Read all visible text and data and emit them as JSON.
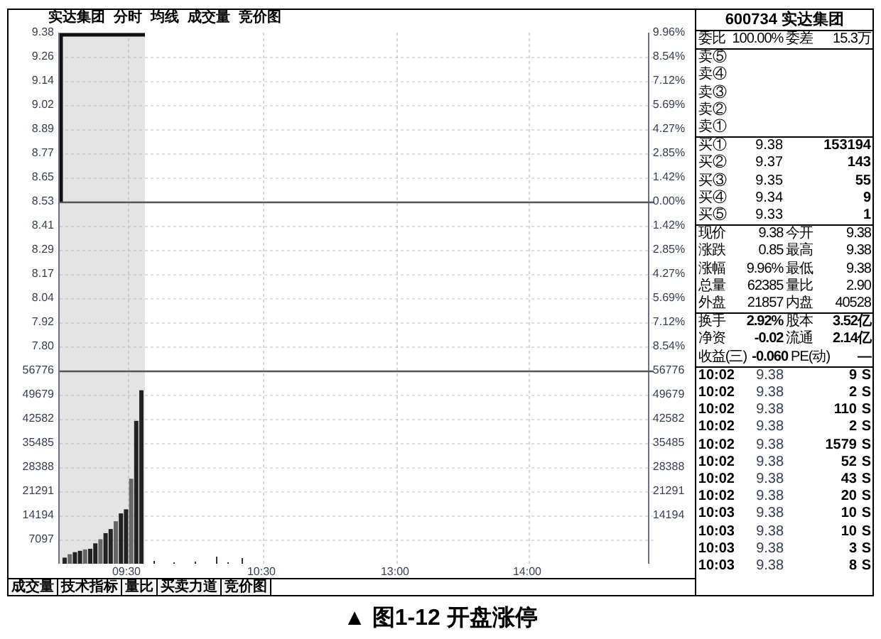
{
  "chart_header": [
    "实达集团",
    "分时",
    "均线",
    "成交量",
    "竞价图"
  ],
  "price_ticks": [
    "9.38",
    "9.26",
    "9.14",
    "9.02",
    "8.89",
    "8.77",
    "8.65",
    "8.53",
    "8.41",
    "8.29",
    "8.17",
    "8.04",
    "7.92",
    "7.80"
  ],
  "volume_ticks": [
    "56776",
    "49679",
    "42582",
    "35485",
    "28388",
    "21291",
    "14194",
    "7097"
  ],
  "percent_ticks": [
    "9.96%",
    "8.54%",
    "7.12%",
    "5.69%",
    "4.27%",
    "2.85%",
    "1.42%",
    "0.00%",
    "1.42%",
    "2.85%",
    "4.27%",
    "5.69%",
    "7.12%",
    "8.54%"
  ],
  "right_volume_ticks": [
    "56776",
    "49679",
    "42582",
    "35485",
    "28388",
    "21291",
    "14194"
  ],
  "time_ticks": [
    "09:30",
    "10:30",
    "13:00",
    "14:00"
  ],
  "bottom_tabs": [
    "成交量",
    "技术指标",
    "量比",
    "买卖力道",
    "竞价图"
  ],
  "quote": {
    "title": "600734 实达集团",
    "order_ratio": [
      "委比",
      "100.00%",
      "委差",
      "15.3万"
    ],
    "sell": [
      "卖⑤",
      "卖④",
      "卖③",
      "卖②",
      "卖①"
    ],
    "buy": [
      {
        "label": "买①",
        "price": "9.38",
        "volume": "153194"
      },
      {
        "label": "买②",
        "price": "9.37",
        "volume": "143"
      },
      {
        "label": "买③",
        "price": "9.35",
        "volume": "55"
      },
      {
        "label": "买④",
        "price": "9.34",
        "volume": "9"
      },
      {
        "label": "买⑤",
        "price": "9.33",
        "volume": "1"
      }
    ],
    "stats": [
      [
        "现价",
        "9.38",
        "今开",
        "9.38"
      ],
      [
        "涨跌",
        "0.85",
        "最高",
        "9.38"
      ],
      [
        "涨幅",
        "9.96%",
        "最低",
        "9.38"
      ],
      [
        "总量",
        "62385",
        "量比",
        "2.90"
      ],
      [
        "外盘",
        "21857",
        "内盘",
        "40528"
      ]
    ],
    "stats2": [
      [
        "换手",
        "2.92%",
        "股本",
        "3.52亿"
      ],
      [
        "净资",
        "-0.02",
        "流通",
        "2.14亿"
      ],
      [
        "收益(三)",
        "-0.060",
        "PE(动)",
        "—"
      ]
    ],
    "ticks": [
      {
        "time": "10:02",
        "price": "9.38",
        "volume": "9",
        "side": "S"
      },
      {
        "time": "10:02",
        "price": "9.38",
        "volume": "2",
        "side": "S"
      },
      {
        "time": "10:02",
        "price": "9.38",
        "volume": "110",
        "side": "S"
      },
      {
        "time": "10:02",
        "price": "9.38",
        "volume": "2",
        "side": "S"
      },
      {
        "time": "10:02",
        "price": "9.38",
        "volume": "1579",
        "side": "S"
      },
      {
        "time": "10:02",
        "price": "9.38",
        "volume": "52",
        "side": "S"
      },
      {
        "time": "10:02",
        "price": "9.38",
        "volume": "43",
        "side": "S"
      },
      {
        "time": "10:02",
        "price": "9.38",
        "volume": "20",
        "side": "S"
      },
      {
        "time": "10:03",
        "price": "9.38",
        "volume": "10",
        "side": "S"
      },
      {
        "time": "10:03",
        "price": "9.38",
        "volume": "10",
        "side": "S"
      },
      {
        "time": "10:03",
        "price": "9.38",
        "volume": "3",
        "side": "S"
      },
      {
        "time": "10:03",
        "price": "9.38",
        "volume": "8",
        "side": "S"
      }
    ]
  },
  "caption": "▲ 图1-12 开盘涨停"
}
